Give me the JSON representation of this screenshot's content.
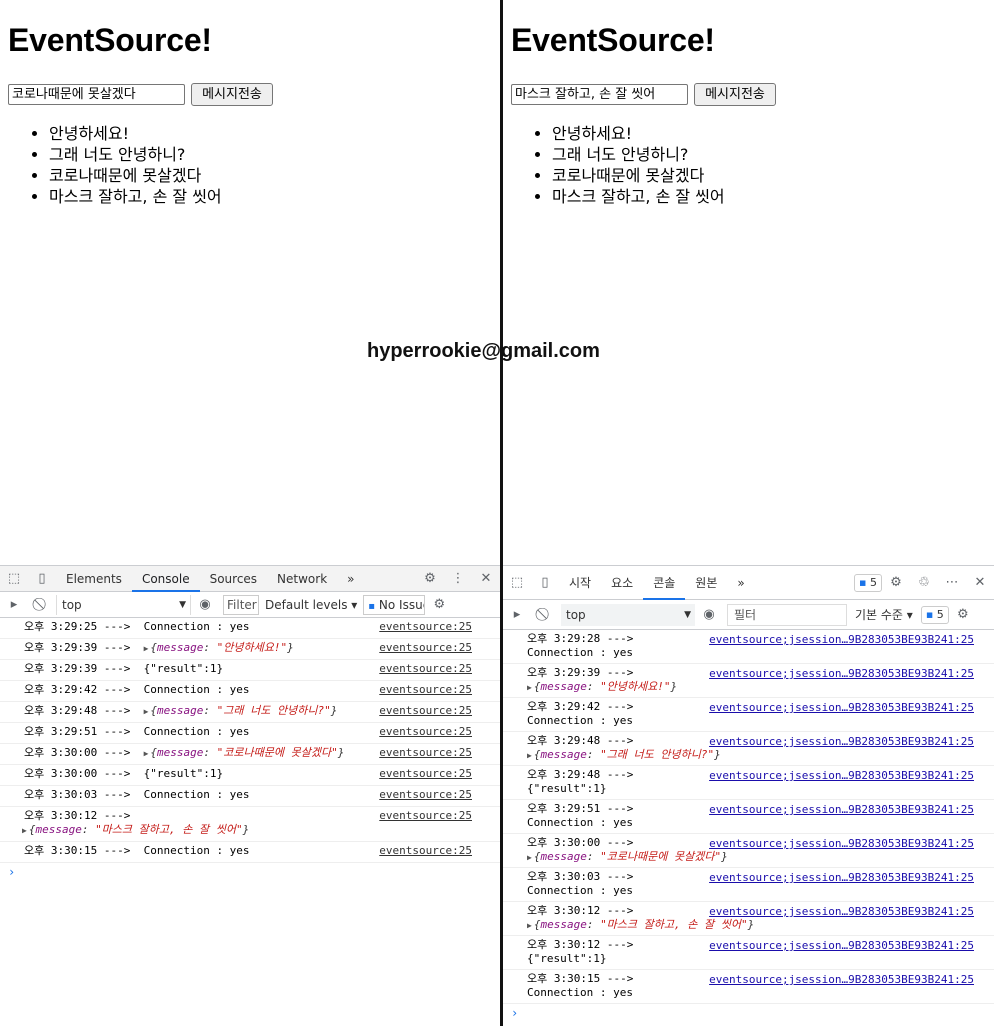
{
  "watermark": "hyperrookie@gmail.com",
  "left": {
    "page": {
      "title": "EventSource!",
      "input_value": "코로나때문에 못살겠다",
      "send_label": "메시지전송",
      "messages": [
        "안녕하세요!",
        "그래 너도 안녕하니?",
        "코로나때문에 못살겠다",
        "마스크 잘하고, 손 잘 씻어"
      ]
    },
    "devtools": {
      "tabs": [
        "Elements",
        "Console",
        "Sources",
        "Network"
      ],
      "more_tabs": "»",
      "context": "top",
      "filter_placeholder": "Filter",
      "levels": "Default levels",
      "issues": "No Issue",
      "logs": [
        {
          "time": "오후 3:29:25 --->",
          "msg": "Connection : yes",
          "src": "eventsource:25"
        },
        {
          "time": "오후 3:29:39 --->",
          "obj_key": "message",
          "obj_val": "\"안녕하세요!\"",
          "src": "eventsource:25"
        },
        {
          "time": "오후 3:29:39 --->",
          "msg": "{\"result\":1}",
          "src": "eventsource:25"
        },
        {
          "time": "오후 3:29:42 --->",
          "msg": "Connection : yes",
          "src": "eventsource:25"
        },
        {
          "time": "오후 3:29:48 --->",
          "obj_key": "message",
          "obj_val": "\"그래 너도 안녕하니?\"",
          "src": "eventsource:25"
        },
        {
          "time": "오후 3:29:51 --->",
          "msg": "Connection : yes",
          "src": "eventsource:25"
        },
        {
          "time": "오후 3:30:00 --->",
          "obj_key": "message",
          "obj_val": "\"코로나때문에 못살겠다\"",
          "src": "eventsource:25"
        },
        {
          "time": "오후 3:30:00 --->",
          "msg": "{\"result\":1}",
          "src": "eventsource:25"
        },
        {
          "time": "오후 3:30:03 --->",
          "msg": "Connection : yes",
          "src": "eventsource:25"
        },
        {
          "time": "오후 3:30:12 --->",
          "obj_key": "message",
          "obj_val": "\"마스크 잘하고, 손 잘 씻어\"",
          "src": "eventsource:25",
          "wrap": true
        },
        {
          "time": "오후 3:30:15 --->",
          "msg": "Connection : yes",
          "src": "eventsource:25"
        }
      ],
      "prompt": "›"
    }
  },
  "right": {
    "page": {
      "title": "EventSource!",
      "input_value": "마스크 잘하고, 손 잘 씻어",
      "send_label": "메시지전송",
      "messages": [
        "안녕하세요!",
        "그래 너도 안녕하니?",
        "코로나때문에 못살겠다",
        "마스크 잘하고, 손 잘 씻어"
      ]
    },
    "devtools": {
      "tabs": [
        "시작",
        "요소",
        "콘솔",
        "원본"
      ],
      "more_tabs": "»",
      "issues_count": "5",
      "context": "top",
      "filter_placeholder": "필터",
      "levels": "기본 수준",
      "logs": [
        {
          "time": "오후 3:29:28 --->",
          "msg": "Connection : yes",
          "src": "eventsource;jsession…9B283053BE93B241:25"
        },
        {
          "time": "오후 3:29:39 --->",
          "obj_key": "message",
          "obj_val": "\"안녕하세요!\"",
          "src": "eventsource;jsession…9B283053BE93B241:25"
        },
        {
          "time": "오후 3:29:42 --->",
          "msg": "Connection : yes",
          "src": "eventsource;jsession…9B283053BE93B241:25"
        },
        {
          "time": "오후 3:29:48 --->",
          "obj_key": "message",
          "obj_val": "\"그래 너도 안녕하니?\"",
          "src": "eventsource;jsession…9B283053BE93B241:25"
        },
        {
          "time": "오후 3:29:48 --->",
          "msg": "{\"result\":1}",
          "src": "eventsource;jsession…9B283053BE93B241:25"
        },
        {
          "time": "오후 3:29:51 --->",
          "msg": "Connection : yes",
          "src": "eventsource;jsession…9B283053BE93B241:25"
        },
        {
          "time": "오후 3:30:00 --->",
          "obj_key": "message",
          "obj_val": "\"코로나때문에 못살겠다\"",
          "src": "eventsource;jsession…9B283053BE93B241:25"
        },
        {
          "time": "오후 3:30:03 --->",
          "msg": "Connection : yes",
          "src": "eventsource;jsession…9B283053BE93B241:25"
        },
        {
          "time": "오후 3:30:12 --->",
          "obj_key": "message",
          "obj_val": "\"마스크 잘하고, 손 잘 씻어\"",
          "src": "eventsource;jsession…9B283053BE93B241:25"
        },
        {
          "time": "오후 3:30:12 --->",
          "msg": "{\"result\":1}",
          "src": "eventsource;jsession…9B283053BE93B241:25"
        },
        {
          "time": "오후 3:30:15 --->",
          "msg": "Connection : yes",
          "src": "eventsource;jsession…9B283053BE93B241:25"
        }
      ],
      "prompt": "›"
    }
  }
}
